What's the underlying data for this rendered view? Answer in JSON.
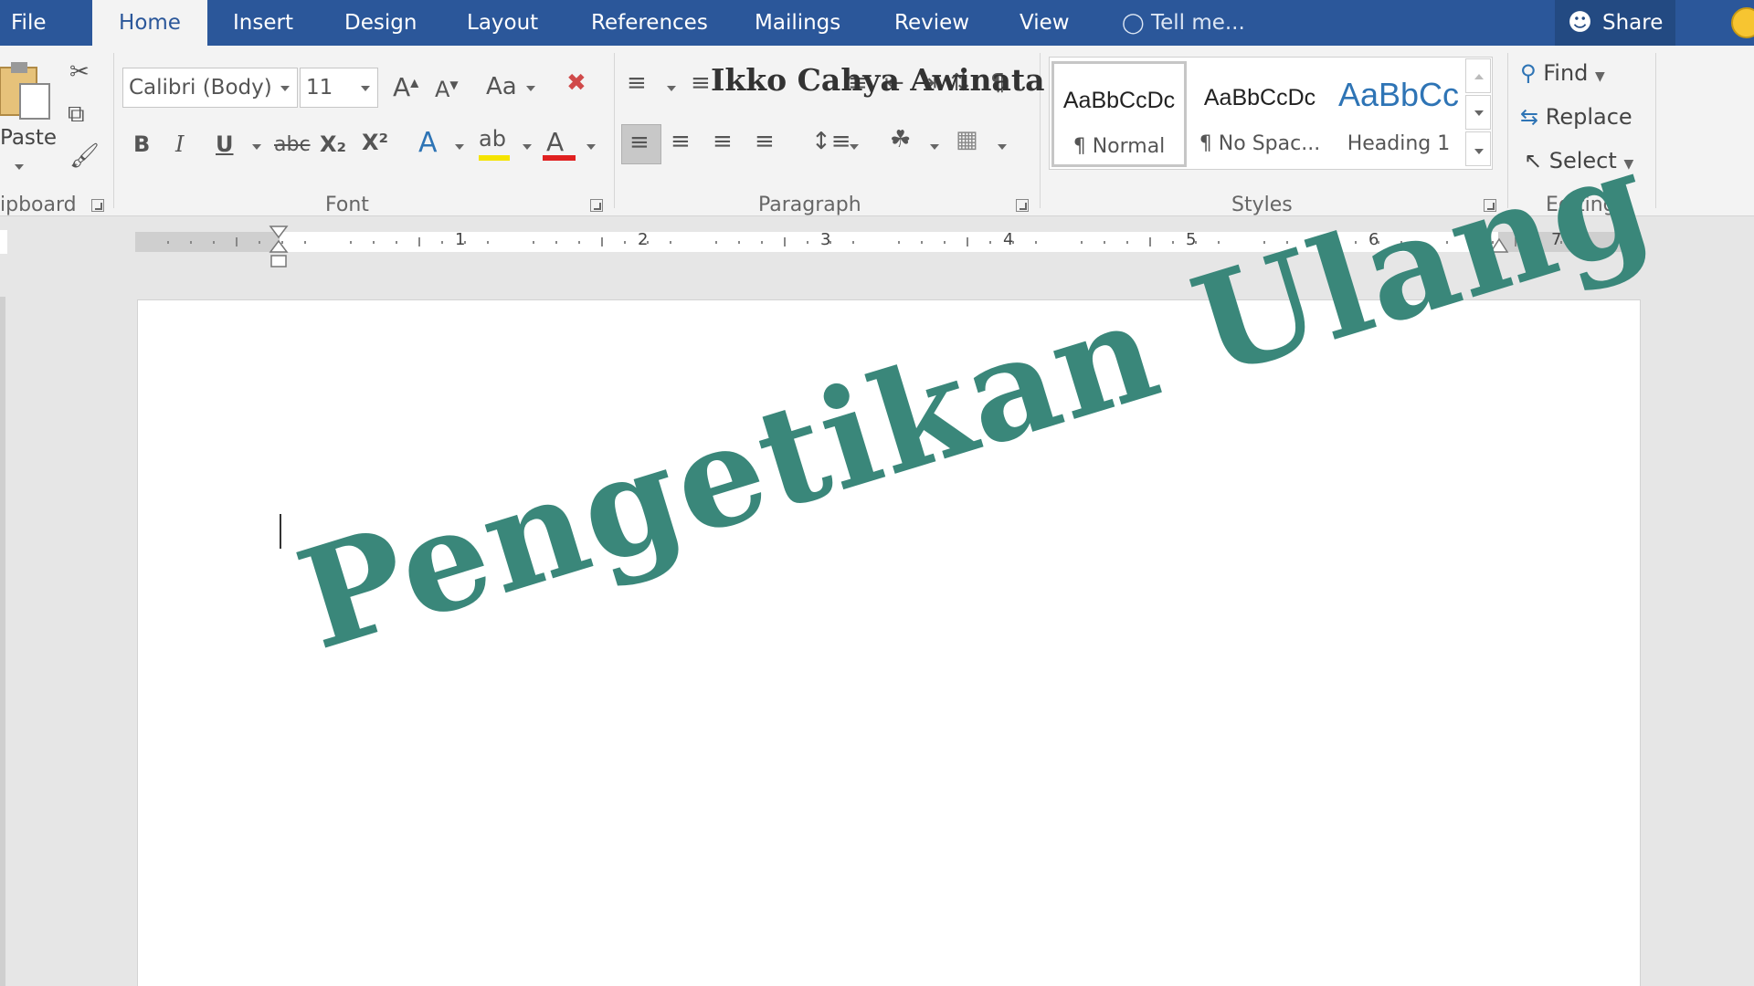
{
  "tabs": {
    "file": "File",
    "home": "Home",
    "insert": "Insert",
    "design": "Design",
    "layout": "Layout",
    "references": "References",
    "mailings": "Mailings",
    "review": "Review",
    "view": "View",
    "tell_me": "Tell me...",
    "share": "Share"
  },
  "clipboard": {
    "paste": "Paste",
    "label": "ipboard"
  },
  "font": {
    "family": "Calibri (Body)",
    "size": "11",
    "change_case": "Aa",
    "bold": "B",
    "italic": "I",
    "underline": "U",
    "strike": "abc",
    "subscript": "X₂",
    "superscript": "X²",
    "label": "Font",
    "highlight_color": "#f5e400",
    "font_color": "#e02020"
  },
  "paragraph": {
    "label": "Paragraph"
  },
  "styles": {
    "label": "Styles",
    "items": [
      {
        "sample": "AaBbCcDc",
        "name": "¶ Normal"
      },
      {
        "sample": "AaBbCcDc",
        "name": "¶ No Spac..."
      },
      {
        "sample": "AaBbCc",
        "name": "Heading 1"
      }
    ],
    "heading_color": "#2e74b5"
  },
  "editing": {
    "label": "Editing",
    "find": "Find",
    "replace": "Replace",
    "select": "Select"
  },
  "ruler": {
    "numbers": [
      "1",
      "2",
      "3",
      "4",
      "5",
      "6",
      "7"
    ]
  },
  "document": {
    "wordart": "Pengetikan Ulang",
    "wordart_color": "#3a877a"
  },
  "watermark": "Ikko Cahya Awinata",
  "colors": {
    "title_bar": "#2b579a",
    "ribbon": "#f3f3f3"
  }
}
